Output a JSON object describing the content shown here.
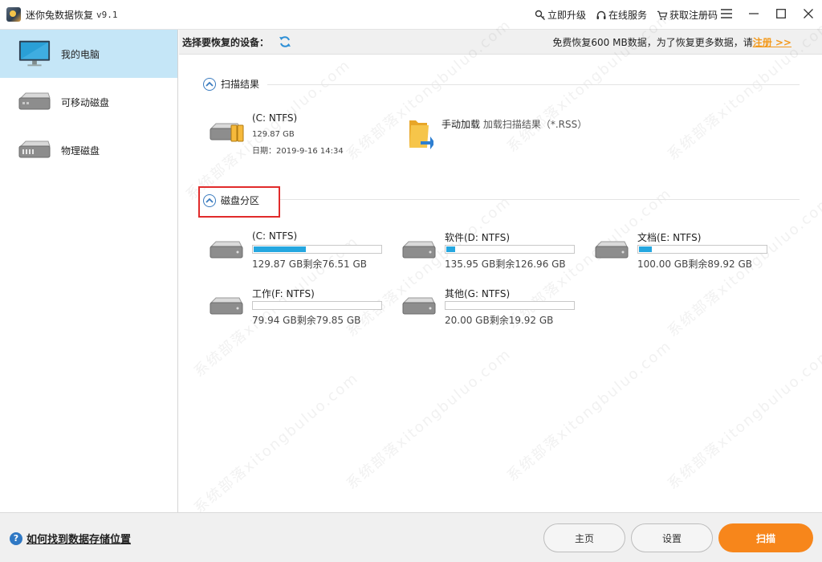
{
  "app": {
    "title": "迷你兔数据恢复",
    "version": "v9.1"
  },
  "title_actions": [
    {
      "label": "立即升级",
      "icon": "key-icon"
    },
    {
      "label": "在线服务",
      "icon": "headset-icon"
    },
    {
      "label": "获取注册码",
      "icon": "cart-icon"
    }
  ],
  "window_controls": [
    "menu-icon",
    "minimize-icon",
    "maximize-icon",
    "close-icon"
  ],
  "sidebar": {
    "items": [
      {
        "label": "我的电脑",
        "icon": "monitor-icon",
        "active": true
      },
      {
        "label": "可移动磁盘",
        "icon": "removable-disk-icon",
        "active": false
      },
      {
        "label": "物理磁盘",
        "icon": "physical-disk-icon",
        "active": false
      }
    ]
  },
  "header": {
    "select_device_label": "选择要恢复的设备：",
    "free_notice": "免费恢复600 MB数据，为了恢复更多数据，请",
    "register_link": "注册 >>"
  },
  "scan_results": {
    "title": "扫描结果",
    "item": {
      "name": "(C: NTFS)",
      "size": "129.87 GB",
      "date": "日期：2019-9-16 14:34"
    },
    "manual_load": {
      "title": "手动加载",
      "subtitle": "加载扫描结果（*.RSS）"
    }
  },
  "partitions": {
    "title": "磁盘分区",
    "drives": [
      {
        "name": "(C: NTFS)",
        "capacity": "129.87 GB剩余76.51 GB",
        "used_fraction": 0.41
      },
      {
        "name": "软件(D: NTFS)",
        "capacity": "135.95 GB剩余126.96 GB",
        "used_fraction": 0.07
      },
      {
        "name": "文档(E: NTFS)",
        "capacity": "100.00 GB剩余89.92 GB",
        "used_fraction": 0.1
      },
      {
        "name": "工作(F: NTFS)",
        "capacity": "79.94 GB剩余79.85 GB",
        "used_fraction": 0.0
      },
      {
        "name": "其他(G: NTFS)",
        "capacity": "20.00 GB剩余19.92 GB",
        "used_fraction": 0.0
      }
    ]
  },
  "footer": {
    "help_text": "如何找到数据存储位置",
    "home_button": "主页",
    "settings_button": "设置",
    "scan_button": "扫描"
  },
  "watermark": "系统部落xitongbuluo.com",
  "colors": {
    "accent": "#25a7e0",
    "active_sidebar": "#c5e6f7",
    "scan_button": "#f7861b",
    "highlight_box": "#e12b2b",
    "register_link": "#f39a1e"
  }
}
